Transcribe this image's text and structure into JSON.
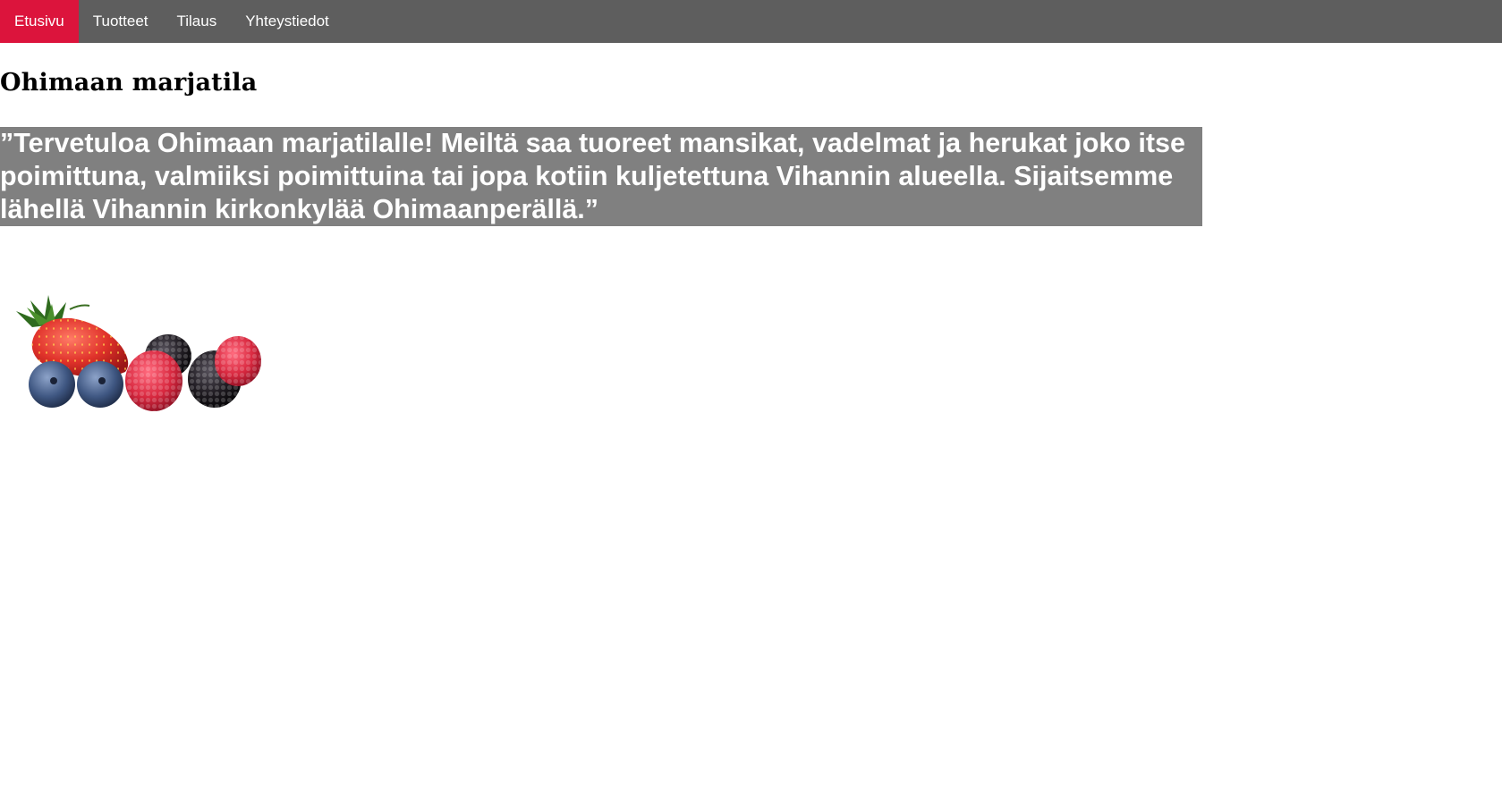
{
  "nav": {
    "items": [
      {
        "label": "Etusivu",
        "active": true
      },
      {
        "label": "Tuotteet",
        "active": false
      },
      {
        "label": "Tilaus",
        "active": false
      },
      {
        "label": "Yhteystiedot",
        "active": false
      }
    ],
    "background_color": "#5e5e5e",
    "active_color": "#dc143c"
  },
  "page": {
    "title": "Ohimaan marjatila",
    "welcome_text": "”Tervetuloa Ohimaan marjatilalle! Meiltä saa tuoreet mansikat, vadelmat ja herukat joko itse poimittuna, valmiiksi poimittuina tai jopa kotiin kuljetettuna Vihannin alueella. Sijaitsemme lähellä Vihannin kirkonkylää Ohimaanperällä.”",
    "welcome_background": "#808080",
    "image_subject": "berries-image"
  }
}
